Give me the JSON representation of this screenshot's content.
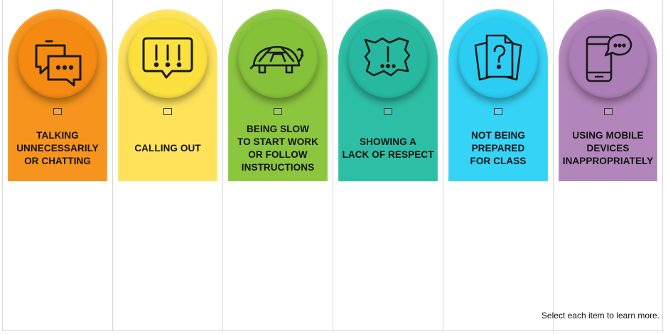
{
  "items": [
    {
      "label": "TALKING\nUNNECESSARILY\nOR CHATTING",
      "icon": "chat-bubbles-icon",
      "color": "#f7941d",
      "disc_color": "#f48a12"
    },
    {
      "label": "CALLING OUT",
      "icon": "exclamation-bubble-icon",
      "color": "#ffe25a",
      "disc_color": "#fbe03e"
    },
    {
      "label": "BEING SLOW\nTO START WORK\nOR FOLLOW\nINSTRUCTIONS",
      "icon": "turtle-icon",
      "color": "#8cc63f",
      "disc_color": "#86c13a"
    },
    {
      "label": "SHOWING A\nLACK OF RESPECT",
      "icon": "exclamation-burst-icon",
      "color": "#2dbfa6",
      "disc_color": "#26b9a0"
    },
    {
      "label": "NOT BEING\nPREPARED\nFOR CLASS",
      "icon": "question-papers-icon",
      "color": "#35d3f6",
      "disc_color": "#2ccdf2"
    },
    {
      "label": "USING MOBILE\nDEVICES\nINAPPROPRIATELY",
      "icon": "mobile-phone-chat-icon",
      "color": "#b286bb",
      "disc_color": "#ab7fb5"
    }
  ],
  "hint": "Select each item to learn more."
}
